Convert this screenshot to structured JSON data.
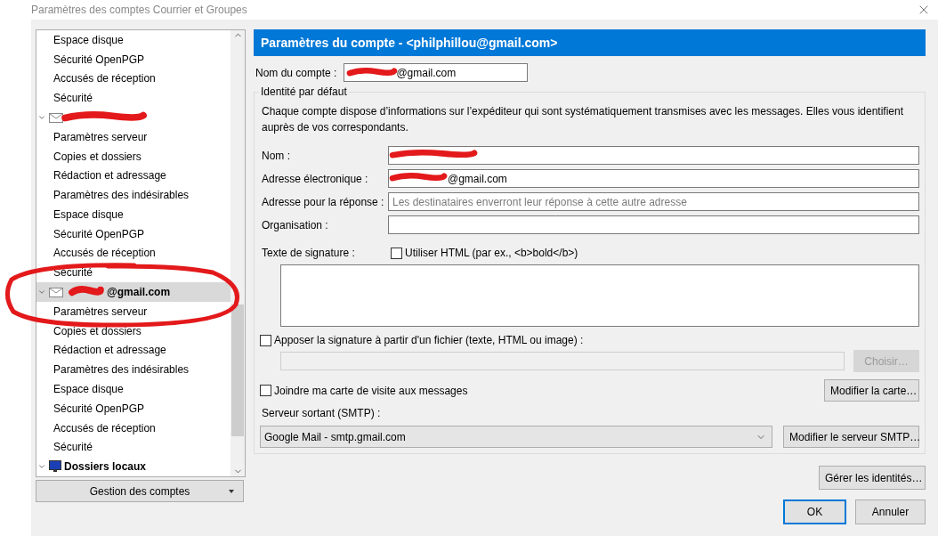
{
  "window": {
    "title": "Paramètres des comptes Courrier et Groupes"
  },
  "tree": {
    "items": [
      {
        "kind": "continued",
        "children": [
          {
            "label": "Espace disque",
            "selected": false
          },
          {
            "label": "Sécurité OpenPGP",
            "selected": false
          },
          {
            "label": "Accusés de réception",
            "selected": false
          },
          {
            "label": "Sécurité",
            "selected": false
          }
        ]
      },
      {
        "kind": "account",
        "expanded": true,
        "selected": false,
        "redacted": true,
        "children": [
          {
            "label": "Paramètres serveur",
            "selected": false
          },
          {
            "label": "Copies et dossiers",
            "selected": false
          },
          {
            "label": "Rédaction et adressage",
            "selected": false
          },
          {
            "label": "Paramètres des indésirables",
            "selected": false
          },
          {
            "label": "Espace disque",
            "selected": false
          },
          {
            "label": "Sécurité OpenPGP",
            "selected": false
          },
          {
            "label": "Accusés de réception",
            "selected": false
          },
          {
            "label": "Sécurité",
            "selected": false
          }
        ]
      },
      {
        "kind": "account",
        "label": "@gmail.com",
        "expanded": true,
        "selected": true,
        "redacted": true,
        "circled": true,
        "children": [
          {
            "label": "Paramètres serveur",
            "selected": false
          },
          {
            "label": "Copies et dossiers",
            "selected": false
          },
          {
            "label": "Rédaction et adressage",
            "selected": false
          },
          {
            "label": "Paramètres des indésirables",
            "selected": false
          },
          {
            "label": "Espace disque",
            "selected": false
          },
          {
            "label": "Sécurité OpenPGP",
            "selected": false
          },
          {
            "label": "Accusés de réception",
            "selected": false
          },
          {
            "label": "Sécurité",
            "selected": false
          }
        ]
      },
      {
        "kind": "folders",
        "label": "Dossiers locaux",
        "expanded": true,
        "selected": false
      }
    ]
  },
  "manage_button": {
    "label": "Gestion des comptes"
  },
  "panel": {
    "header": "Paramètres du compte - <philphillou@gmail.com>",
    "account_name": {
      "label": "Nom du compte :",
      "value": "@gmail.com",
      "redacted": true
    },
    "identity": {
      "legend": "Identité par défaut",
      "description": "Chaque compte dispose d’informations sur l’expéditeur qui sont systématiquement transmises avec les messages. Elles vous identifient auprès de vos correspondants.",
      "fields": [
        {
          "label": "Nom :",
          "redacted": true
        },
        {
          "label": "Adresse électronique :",
          "value": "@gmail.com",
          "redacted": true
        },
        {
          "label": "Adresse pour la réponse :",
          "placeholder": "Les destinataires enverront leur réponse à cette autre adresse"
        },
        {
          "label": "Organisation :"
        }
      ],
      "signature_label": "Texte de signature :",
      "use_html": {
        "label": "Utiliser HTML (par ex., <b>bold</b>)",
        "checked": false
      },
      "signature_file": {
        "label": "Apposer la signature à partir d'un fichier (texte, HTML ou image) :",
        "checked": false
      },
      "choose_button": {
        "label": "Choisir…",
        "disabled": true
      },
      "vcard": {
        "label": "Joindre ma carte de visite aux messages",
        "checked": false
      },
      "edit_card_button": {
        "label": "Modifier la carte…"
      },
      "smtp_label": "Serveur sortant (SMTP) :",
      "smtp_select": {
        "value": "Google Mail - smtp.gmail.com"
      },
      "edit_smtp_button": {
        "label": "Modifier le serveur SMTP…"
      }
    },
    "manage_identities_button": {
      "label": "Gérer les identités…"
    }
  },
  "buttons": [
    {
      "label": "OK",
      "default": true
    },
    {
      "label": "Annuler",
      "default": false
    }
  ]
}
